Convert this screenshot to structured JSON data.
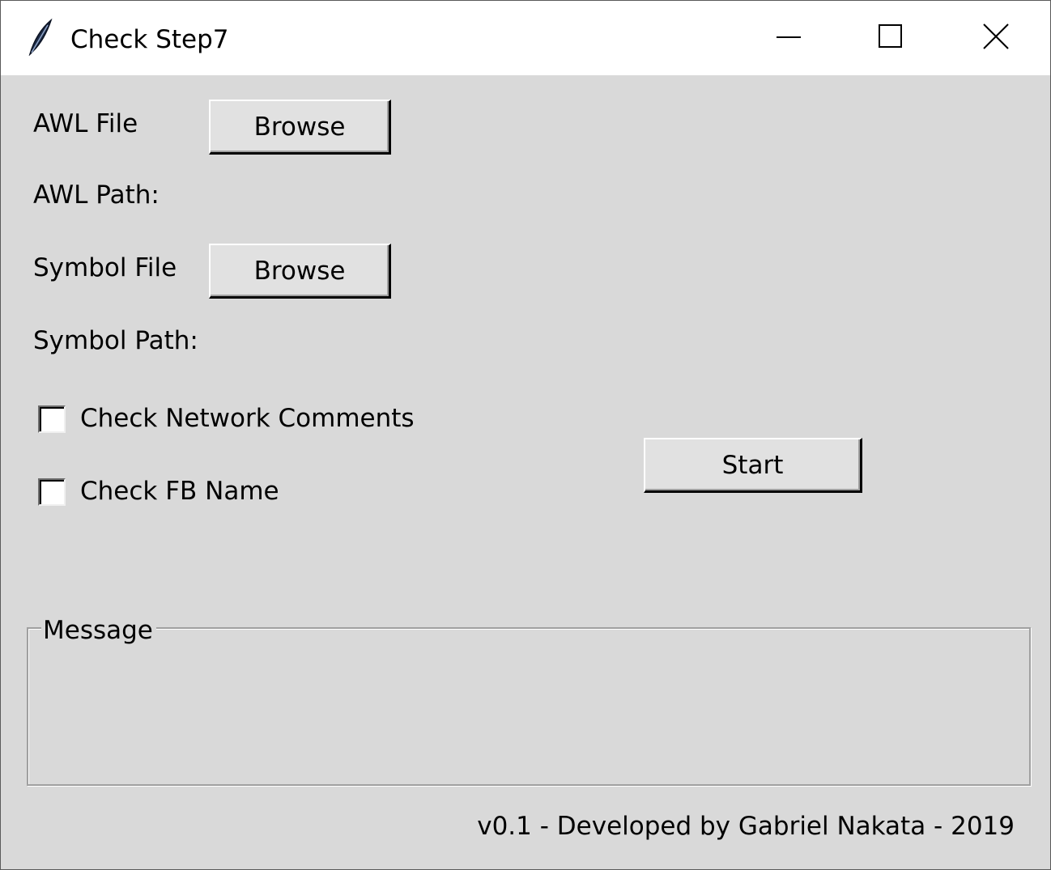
{
  "window": {
    "title": "Check Step7",
    "app_icon": "feather-icon",
    "controls": {
      "minimize_icon": "minimize-icon",
      "maximize_icon": "maximize-icon",
      "close_icon": "close-icon"
    }
  },
  "form": {
    "awl_file_label": "AWL File",
    "awl_browse_label": "Browse",
    "awl_path_label": "AWL Path:",
    "symbol_file_label": "Symbol File",
    "symbol_browse_label": "Browse",
    "symbol_path_label": "Symbol Path:",
    "check_network_comments": {
      "label": "Check Network Comments",
      "checked": false
    },
    "check_fb_name": {
      "label": "Check FB Name",
      "checked": false
    },
    "start_label": "Start"
  },
  "message": {
    "legend": "Message",
    "content": ""
  },
  "footer": {
    "text": "v0.1 - Developed by Gabriel Nakata - 2019"
  },
  "colors": {
    "window_bg": "#d9d9d9",
    "titlebar_bg": "#ffffff",
    "button_bg": "#e1e1e1"
  }
}
